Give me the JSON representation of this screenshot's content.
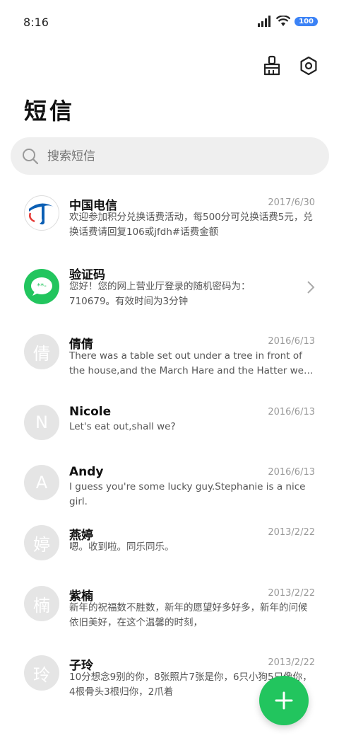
{
  "status": {
    "time": "8:16",
    "battery": "100"
  },
  "title": "短信",
  "search": {
    "placeholder": "搜索短信"
  },
  "messages": [
    {
      "avatar": "",
      "name": "中国电信",
      "date": "2017/6/30",
      "preview": "欢迎参加积分兑换话费活动，每500分可兑换话费5元，兑换话费请回复106或jfdh#话费金额"
    },
    {
      "avatar": "",
      "name": "验证码",
      "date": "",
      "preview": "您好！您的网上营业厅登录的随机密码为：710679。有效时间为3分钟"
    },
    {
      "avatar": "倩",
      "name": "倩倩",
      "date": "2016/6/13",
      "preview": "There was a table set out under a tree in front of the house,and the March Hare and the Hatter were having tea"
    },
    {
      "avatar": "N",
      "name": "Nicole",
      "date": "2016/6/13",
      "preview": "Let's eat out,shall we?"
    },
    {
      "avatar": "A",
      "name": "Andy",
      "date": "2016/6/13",
      "preview": "I guess you're some lucky guy.Stephanie is a nice girl."
    },
    {
      "avatar": "婷",
      "name": "燕婷",
      "date": "2013/2/22",
      "preview": "嗯。收到啦。同乐同乐。"
    },
    {
      "avatar": "楠",
      "name": "紫楠",
      "date": "2013/2/22",
      "preview": "新年的祝福数不胜数，新年的愿望好多好多，新年的问候依旧美好，在这个温馨的时刻，"
    },
    {
      "avatar": "玲",
      "name": "子玲",
      "date": "2013/2/22",
      "preview": "10分想念9别的你，8张照片7张是你，6只小狗5只像你，4根骨头3根归你，2爪着"
    }
  ],
  "colors": {
    "fab": "#22c55e",
    "telecom_blue": "#0b5fb4",
    "verify_green": "#22c55e",
    "avatar_gray": "#e5e5e5"
  }
}
